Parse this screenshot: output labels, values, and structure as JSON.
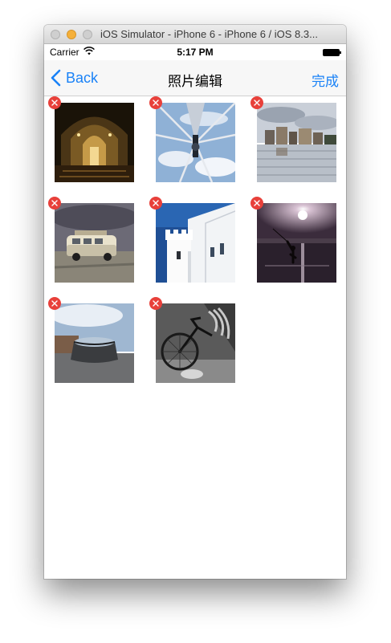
{
  "window": {
    "title": "iOS Simulator - iPhone 6 - iPhone 6 / iOS 8.3..."
  },
  "status_bar": {
    "carrier": "Carrier",
    "time": "5:17 PM",
    "icons": [
      "wifi-icon",
      "battery-icon"
    ]
  },
  "nav_bar": {
    "back_label": "Back",
    "title": "照片编辑",
    "done_label": "完成",
    "accent_color": "#1a82f7"
  },
  "photos": [
    {
      "subject": "church-interior"
    },
    {
      "subject": "ferris-wheel-spokes"
    },
    {
      "subject": "flooded-town"
    },
    {
      "subject": "vw-van"
    },
    {
      "subject": "white-tower"
    },
    {
      "subject": "fisherman-sunset"
    },
    {
      "subject": "cylinder-pavilion"
    },
    {
      "subject": "bicycle-bw"
    }
  ],
  "delete_icon": "close-icon",
  "delete_color": "#e8403a"
}
